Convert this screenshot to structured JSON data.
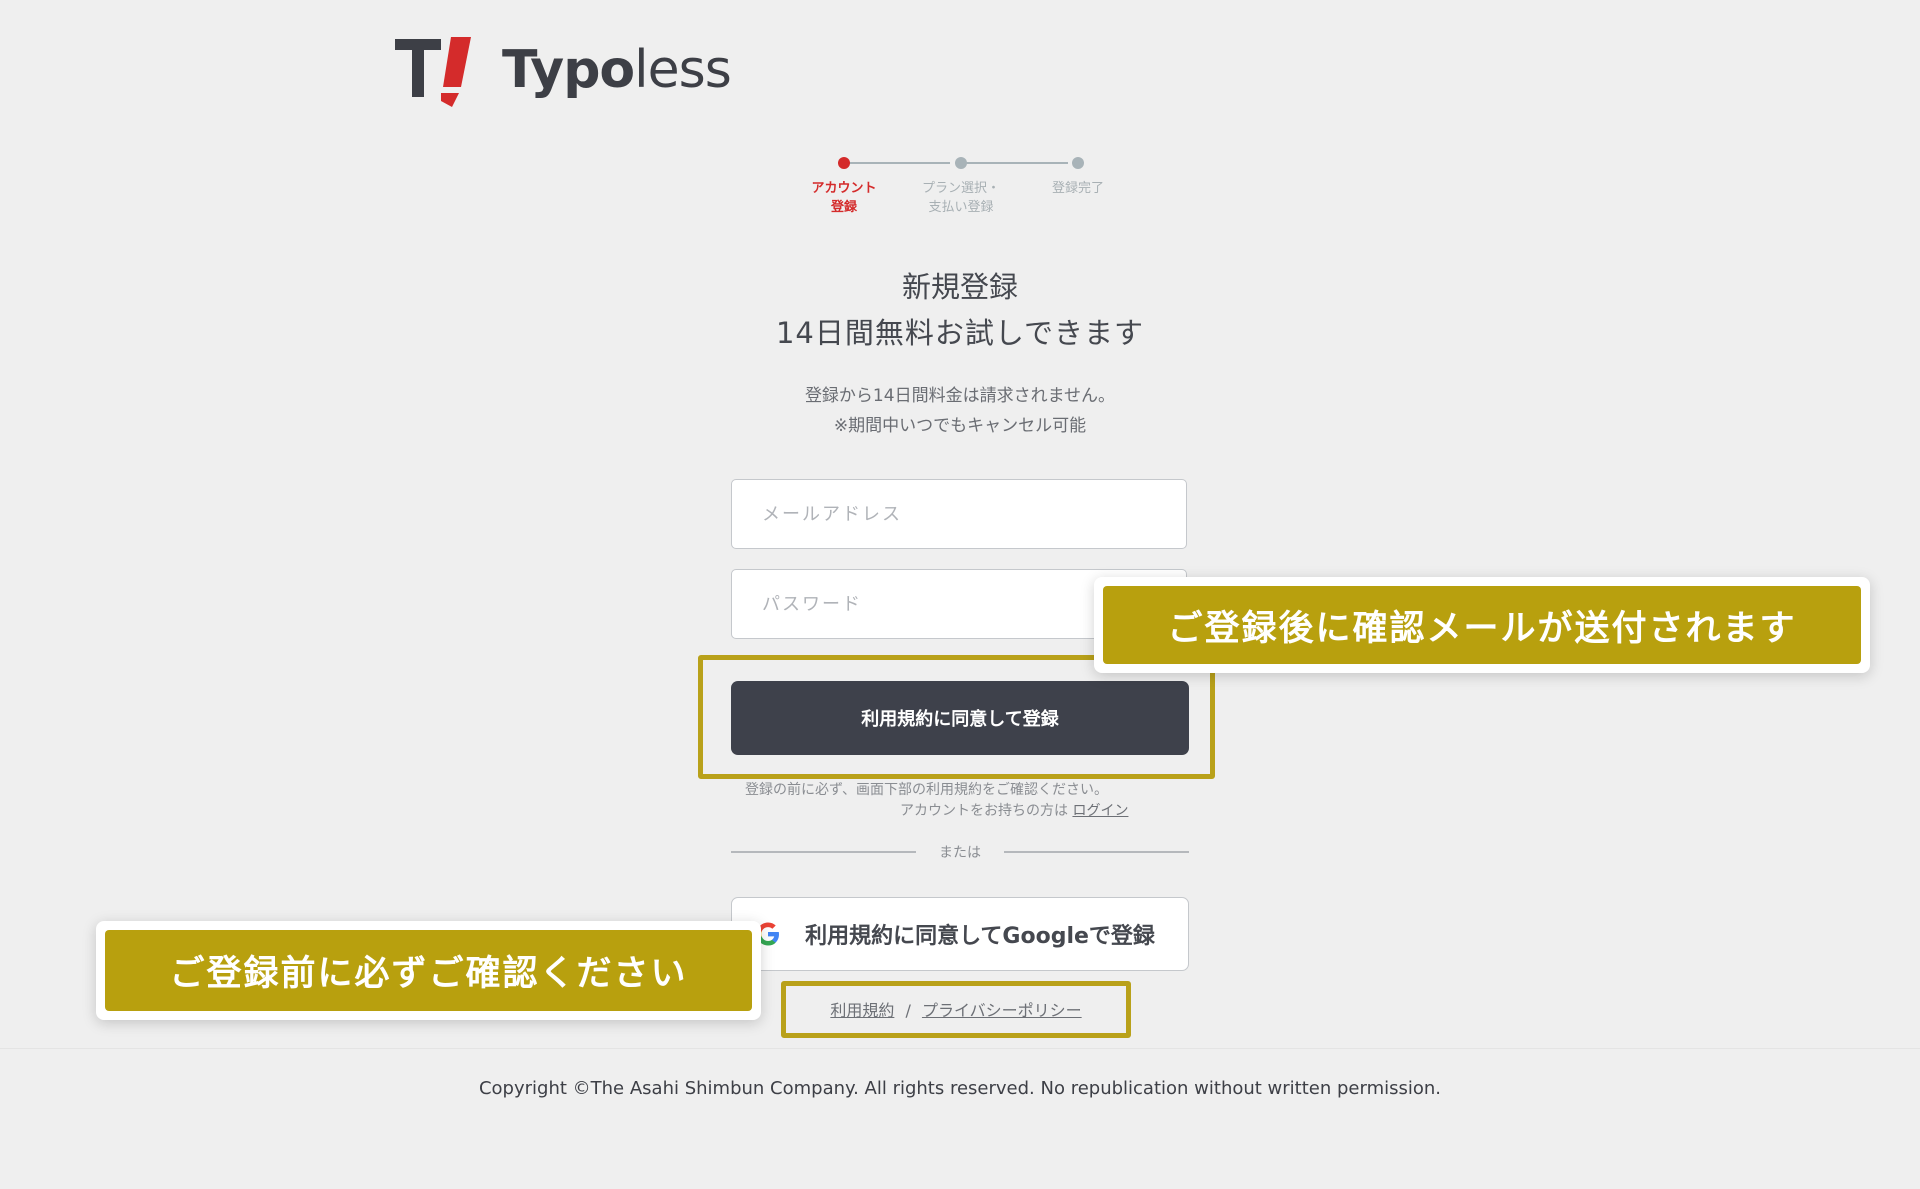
{
  "brand": {
    "mark": "T!",
    "name_bold": "Typo",
    "name_light": "less",
    "accent": "#d42b2b"
  },
  "stepper": {
    "steps": [
      {
        "label": "アカウント\n登録",
        "active": true
      },
      {
        "label": "プラン選択・\n支払い登録",
        "active": false
      },
      {
        "label": "登録完了",
        "active": false
      }
    ]
  },
  "heading": {
    "title": "新規登録",
    "subtitle": "14日間無料お試しできます"
  },
  "notes": {
    "line1": "登録から14日間料金は請求されません。",
    "line2": "※期間中いつでもキャンセル可能"
  },
  "form": {
    "email_placeholder": "メールアドレス",
    "email_value": "",
    "password_placeholder": "パスワード",
    "password_value": "",
    "submit_label": "利用規約に同意して登録",
    "terms_note": "登録の前に必ず、画面下部の利用規約をご確認ください。",
    "login_prompt": "アカウントをお持ちの方は",
    "login_link": "ログイン"
  },
  "divider": {
    "text": "または"
  },
  "google": {
    "label": "利用規約に同意してGoogleで登録",
    "icon": "google-g-icon"
  },
  "policy": {
    "terms": "利用規約",
    "separator": "/",
    "privacy": "プライバシーポリシー"
  },
  "callouts": {
    "email_confirm": "ご登録後に確認メールが送付されます",
    "check_before": "ご登録前に必ずご確認ください",
    "color": "#b8a00e"
  },
  "footer": {
    "copyright": "Copyright ©The Asahi Shimbun Company. All rights reserved. No republication without written permission."
  }
}
